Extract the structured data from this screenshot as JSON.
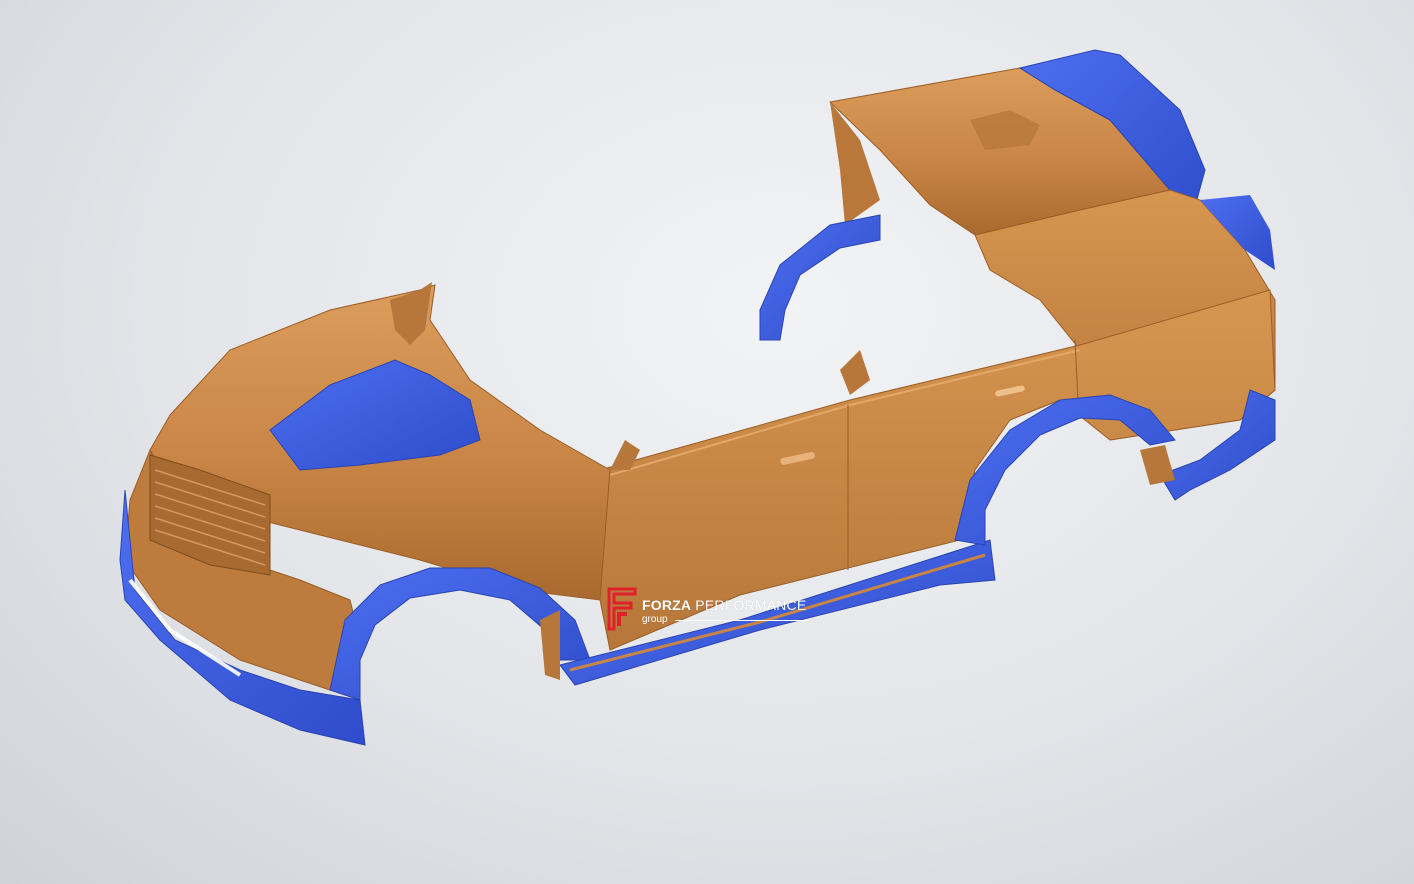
{
  "scene": {
    "subject": "car-body-kit-3d-model",
    "colors": {
      "background": "#e3e5e9",
      "body_panel": "#c98545",
      "body_panel_shadow": "#a5652c",
      "body_panel_highlight": "#e0a464",
      "kit_part": "#3c60e0",
      "kit_part_shadow": "#2a44b0"
    }
  },
  "watermark": {
    "brand_bold": "FORZA",
    "brand_light": " PERFORMANCE",
    "sub": "group",
    "mark_color": "#e0202a",
    "text_color": "#ffffff"
  }
}
